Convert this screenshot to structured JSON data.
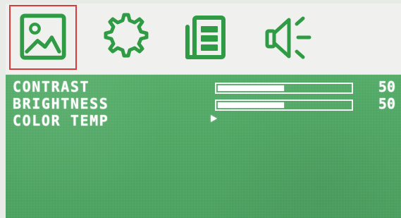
{
  "menu": {
    "tabs": [
      {
        "icon": "picture-icon",
        "selected": true
      },
      {
        "icon": "gear-icon",
        "selected": false
      },
      {
        "icon": "input-icon",
        "selected": false
      },
      {
        "icon": "speaker-icon",
        "selected": false
      }
    ],
    "items": [
      {
        "label": "CONTRAST",
        "value": "50",
        "level_percent": 50
      },
      {
        "label": "BRIGHTNESS",
        "value": "50",
        "level_percent": 50
      },
      {
        "label": "COLOR TEMP"
      }
    ]
  },
  "colors": {
    "background": "#4aa55f",
    "tab_bar": "#f0f1ee",
    "icon_green": "#2f9b44",
    "selected_border": "#d93b3b",
    "text": "#ffffff"
  }
}
